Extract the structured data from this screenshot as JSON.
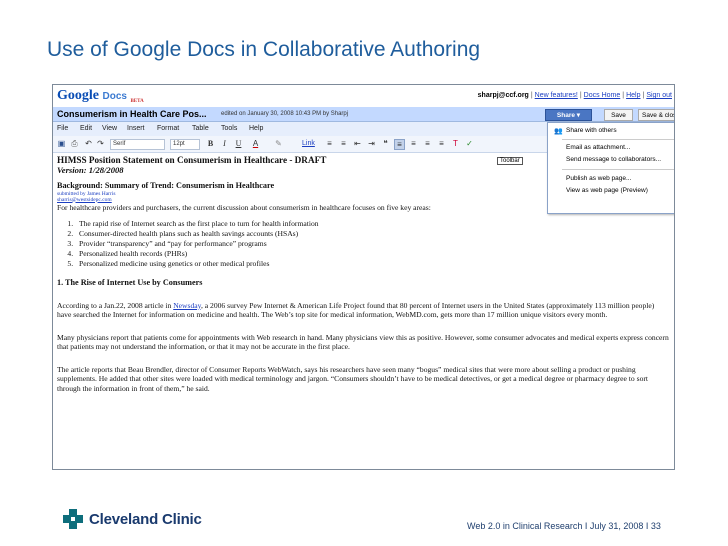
{
  "slide": {
    "title": "Use of Google Docs in Collaborative Authoring",
    "footer": "Web 2.0 in Clinical Research  I  July 31, 2008 I  33",
    "brand": "Cleveland Clinic"
  },
  "gdocs": {
    "logo_google": "Google",
    "logo_docs": "Docs",
    "logo_beta": "BETA",
    "user_email": "sharpj@ccf.org",
    "links": [
      "New features!",
      "Docs Home",
      "Help",
      "Sign out"
    ],
    "doc_title": "Consumerism in Health Care Pos...",
    "doc_meta": "edited on January 30, 2008 10:43 PM by Sharpj",
    "share_label": "Share ▾",
    "save_label": "Save",
    "save_close_label": "Save & close",
    "menu": [
      "File",
      "Edit",
      "View",
      "Insert",
      "Format",
      "Table",
      "Tools",
      "Help"
    ],
    "toolbar": {
      "font": "Serif",
      "size": "12pt",
      "bold": "B",
      "italic": "I",
      "underline": "U",
      "color": "A",
      "link": "Link",
      "tooltip": "Toolbar"
    },
    "share_menu": {
      "share_with_others": "Share with others",
      "email_attachment": "Email as attachment...",
      "send_message": "Send message to collaborators...",
      "publish": "Publish as web page...",
      "view_web": "View as web page (Preview)"
    }
  },
  "document": {
    "heading": "HIMSS Position Statement on Consumerism in Healthcare - DRAFT",
    "version": "Version: 1/28/2008",
    "bg_heading": "Background: Summary of Trend: Consumerism in Healthcare",
    "submitted_by": "submitted by James Harris",
    "submitted_email": "sharris@westsidepc.com",
    "intro": "For healthcare providers and purchasers, the current discussion about consumerism in healthcare focuses on five key areas:",
    "trends": [
      "The rapid rise of Internet search as the first place to turn for health information",
      "Consumer-directed health plans such as health savings accounts (HSAs)",
      "Provider “transparency” and “pay for performance” programs",
      "Personalized health records (PHRs)",
      "Personalized medicine using genetics or other medical profiles"
    ],
    "section1_heading": "1. The Rise of Internet Use by Consumers",
    "para1_pre": "According to a Jan.22, 2008 article in ",
    "para1_link": "Newsday",
    "para1_post": ", a 2006 survey Pew Internet & American Life Project found that 80 percent of Internet users in the United States (approximately 113 million people) have searched the Internet for information on medicine and health. The Web’s top site for medical information, WebMD.com, gets more than 17 million unique visitors every month.",
    "para2": "Many physicians report that patients come for appointments with Web research in hand. Many physicians view this as positive. However, some consumer advocates and medical experts express concern that patients may not understand the information, or that it may not be accurate in the first place.",
    "para3": "The article reports that Beau Brendler, director of Consumer Reports WebWatch, says his researchers have seen many “bogus” medical sites that were more about selling a product or pushing supplements. He added that other sites were loaded with medical terminology and jargon. “Consumers shouldn’t have to be medical detectives, or get a medical degree or pharmacy degree to sort through the information in front of them,” he said."
  }
}
